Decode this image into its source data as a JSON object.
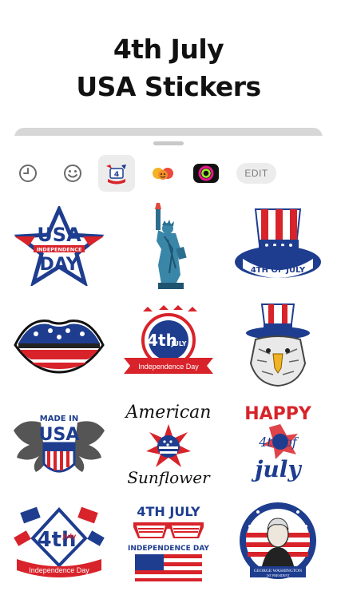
{
  "headline": {
    "line1": "4th July",
    "line2": "USA Stickers"
  },
  "toolbar": {
    "items": [
      {
        "name": "recents",
        "icon": "clock-icon"
      },
      {
        "name": "emoji",
        "icon": "smiley-icon"
      },
      {
        "name": "sticker-pack-usa",
        "icon": "usa-sticker-pack-icon",
        "selected": true
      },
      {
        "name": "sticker-pack-faces",
        "icon": "emoji-faces-pack-icon"
      },
      {
        "name": "sticker-pack-ring",
        "icon": "ring-pack-icon"
      }
    ],
    "edit_label": "EDIT"
  },
  "stickers": [
    {
      "name": "usa-independence-day-star",
      "text": [
        "USA",
        "INDEPENDENCE",
        "DAY"
      ]
    },
    {
      "name": "statue-of-liberty"
    },
    {
      "name": "uncle-sam-hat-4th-of-july",
      "text": [
        "4TH OF JULY"
      ]
    },
    {
      "name": "flag-lips"
    },
    {
      "name": "4th-july-independence-day-badge",
      "text": [
        "4th",
        "JULY",
        "Independence Day"
      ]
    },
    {
      "name": "eagle-in-uncle-sam-hat"
    },
    {
      "name": "made-in-usa-wings",
      "text": [
        "MADE IN",
        "USA"
      ]
    },
    {
      "name": "american-sunflower",
      "text": [
        "American",
        "Sunflower"
      ]
    },
    {
      "name": "happy-4th-of-july-flower",
      "text": [
        "HAPPY",
        "4th of",
        "july"
      ]
    },
    {
      "name": "4th-july-independence-day-flags",
      "text": [
        "4th",
        "July",
        "Independence Day"
      ]
    },
    {
      "name": "4th-july-sunglasses",
      "text": [
        "4TH JULY",
        "INDEPENDENCE DAY"
      ]
    },
    {
      "name": "george-washington-portrait",
      "text": [
        "GEORGE WASHINGTON",
        "1ST PRESIDENT"
      ]
    }
  ],
  "colors": {
    "red": "#d8232a",
    "blue": "#1e3d8f",
    "navy": "#13295e",
    "toolbar_active_bg": "#ececec",
    "edit_text": "#7a7a7a"
  }
}
